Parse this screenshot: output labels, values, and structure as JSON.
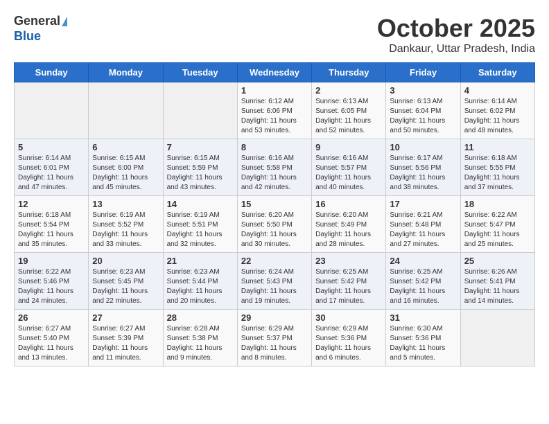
{
  "header": {
    "logo_general": "General",
    "logo_blue": "Blue",
    "month_title": "October 2025",
    "location": "Dankaur, Uttar Pradesh, India"
  },
  "days_of_week": [
    "Sunday",
    "Monday",
    "Tuesday",
    "Wednesday",
    "Thursday",
    "Friday",
    "Saturday"
  ],
  "weeks": [
    [
      {
        "day": "",
        "info": ""
      },
      {
        "day": "",
        "info": ""
      },
      {
        "day": "",
        "info": ""
      },
      {
        "day": "1",
        "info": "Sunrise: 6:12 AM\nSunset: 6:06 PM\nDaylight: 11 hours\nand 53 minutes."
      },
      {
        "day": "2",
        "info": "Sunrise: 6:13 AM\nSunset: 6:05 PM\nDaylight: 11 hours\nand 52 minutes."
      },
      {
        "day": "3",
        "info": "Sunrise: 6:13 AM\nSunset: 6:04 PM\nDaylight: 11 hours\nand 50 minutes."
      },
      {
        "day": "4",
        "info": "Sunrise: 6:14 AM\nSunset: 6:02 PM\nDaylight: 11 hours\nand 48 minutes."
      }
    ],
    [
      {
        "day": "5",
        "info": "Sunrise: 6:14 AM\nSunset: 6:01 PM\nDaylight: 11 hours\nand 47 minutes."
      },
      {
        "day": "6",
        "info": "Sunrise: 6:15 AM\nSunset: 6:00 PM\nDaylight: 11 hours\nand 45 minutes."
      },
      {
        "day": "7",
        "info": "Sunrise: 6:15 AM\nSunset: 5:59 PM\nDaylight: 11 hours\nand 43 minutes."
      },
      {
        "day": "8",
        "info": "Sunrise: 6:16 AM\nSunset: 5:58 PM\nDaylight: 11 hours\nand 42 minutes."
      },
      {
        "day": "9",
        "info": "Sunrise: 6:16 AM\nSunset: 5:57 PM\nDaylight: 11 hours\nand 40 minutes."
      },
      {
        "day": "10",
        "info": "Sunrise: 6:17 AM\nSunset: 5:56 PM\nDaylight: 11 hours\nand 38 minutes."
      },
      {
        "day": "11",
        "info": "Sunrise: 6:18 AM\nSunset: 5:55 PM\nDaylight: 11 hours\nand 37 minutes."
      }
    ],
    [
      {
        "day": "12",
        "info": "Sunrise: 6:18 AM\nSunset: 5:54 PM\nDaylight: 11 hours\nand 35 minutes."
      },
      {
        "day": "13",
        "info": "Sunrise: 6:19 AM\nSunset: 5:52 PM\nDaylight: 11 hours\nand 33 minutes."
      },
      {
        "day": "14",
        "info": "Sunrise: 6:19 AM\nSunset: 5:51 PM\nDaylight: 11 hours\nand 32 minutes."
      },
      {
        "day": "15",
        "info": "Sunrise: 6:20 AM\nSunset: 5:50 PM\nDaylight: 11 hours\nand 30 minutes."
      },
      {
        "day": "16",
        "info": "Sunrise: 6:20 AM\nSunset: 5:49 PM\nDaylight: 11 hours\nand 28 minutes."
      },
      {
        "day": "17",
        "info": "Sunrise: 6:21 AM\nSunset: 5:48 PM\nDaylight: 11 hours\nand 27 minutes."
      },
      {
        "day": "18",
        "info": "Sunrise: 6:22 AM\nSunset: 5:47 PM\nDaylight: 11 hours\nand 25 minutes."
      }
    ],
    [
      {
        "day": "19",
        "info": "Sunrise: 6:22 AM\nSunset: 5:46 PM\nDaylight: 11 hours\nand 24 minutes."
      },
      {
        "day": "20",
        "info": "Sunrise: 6:23 AM\nSunset: 5:45 PM\nDaylight: 11 hours\nand 22 minutes."
      },
      {
        "day": "21",
        "info": "Sunrise: 6:23 AM\nSunset: 5:44 PM\nDaylight: 11 hours\nand 20 minutes."
      },
      {
        "day": "22",
        "info": "Sunrise: 6:24 AM\nSunset: 5:43 PM\nDaylight: 11 hours\nand 19 minutes."
      },
      {
        "day": "23",
        "info": "Sunrise: 6:25 AM\nSunset: 5:42 PM\nDaylight: 11 hours\nand 17 minutes."
      },
      {
        "day": "24",
        "info": "Sunrise: 6:25 AM\nSunset: 5:42 PM\nDaylight: 11 hours\nand 16 minutes."
      },
      {
        "day": "25",
        "info": "Sunrise: 6:26 AM\nSunset: 5:41 PM\nDaylight: 11 hours\nand 14 minutes."
      }
    ],
    [
      {
        "day": "26",
        "info": "Sunrise: 6:27 AM\nSunset: 5:40 PM\nDaylight: 11 hours\nand 13 minutes."
      },
      {
        "day": "27",
        "info": "Sunrise: 6:27 AM\nSunset: 5:39 PM\nDaylight: 11 hours\nand 11 minutes."
      },
      {
        "day": "28",
        "info": "Sunrise: 6:28 AM\nSunset: 5:38 PM\nDaylight: 11 hours\nand 9 minutes."
      },
      {
        "day": "29",
        "info": "Sunrise: 6:29 AM\nSunset: 5:37 PM\nDaylight: 11 hours\nand 8 minutes."
      },
      {
        "day": "30",
        "info": "Sunrise: 6:29 AM\nSunset: 5:36 PM\nDaylight: 11 hours\nand 6 minutes."
      },
      {
        "day": "31",
        "info": "Sunrise: 6:30 AM\nSunset: 5:36 PM\nDaylight: 11 hours\nand 5 minutes."
      },
      {
        "day": "",
        "info": ""
      }
    ]
  ]
}
